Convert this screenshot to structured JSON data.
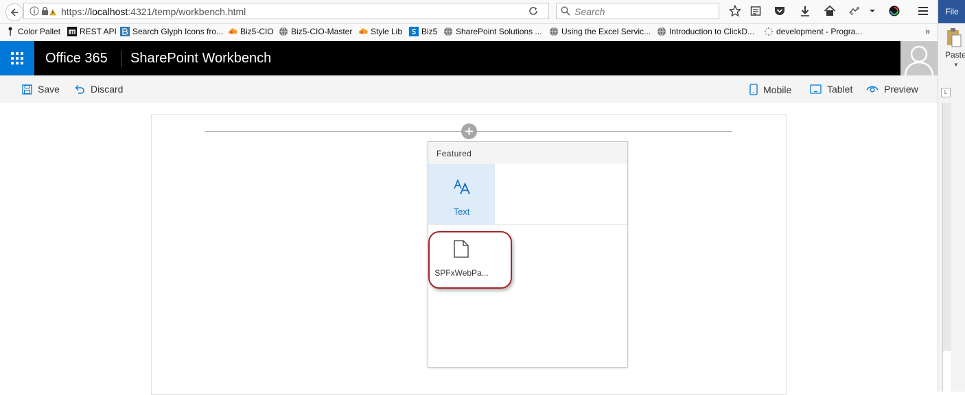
{
  "browser": {
    "url_prefix": "https://",
    "url_host": "localhost",
    "url_rest": ":4321/temp/workbench.html",
    "search_placeholder": "Search"
  },
  "bookmarks": [
    {
      "label": "Color Pallet",
      "icon": "pin-icon"
    },
    {
      "label": "REST API",
      "icon": "m-logo-icon"
    },
    {
      "label": "Search Glyph Icons fro...",
      "icon": "bootstrap-icon"
    },
    {
      "label": "Biz5-CIO",
      "icon": "cloud-icon"
    },
    {
      "label": "Biz5-CIO-Master",
      "icon": "globe-icon"
    },
    {
      "label": "Style Lib",
      "icon": "cloud-icon"
    },
    {
      "label": "Biz5",
      "icon": "sharepoint-icon"
    },
    {
      "label": "SharePoint Solutions ...",
      "icon": "globe-icon"
    },
    {
      "label": "Using the Excel Servic...",
      "icon": "globe-icon"
    },
    {
      "label": "Introduction to ClickD...",
      "icon": "globe-icon"
    },
    {
      "label": "development - Progra...",
      "icon": "spinner-icon"
    }
  ],
  "bookmarks_more": "»",
  "office_panel": {
    "file_tab": "File",
    "paste_label": "Paste"
  },
  "suite": {
    "title": "Office 365",
    "subtitle": "SharePoint Workbench"
  },
  "commands": {
    "save": "Save",
    "discard": "Discard",
    "mobile": "Mobile",
    "tablet": "Tablet",
    "preview": "Preview"
  },
  "toolbox": {
    "header": "Featured",
    "tiles": [
      {
        "label": "Text",
        "icon": "text-icon",
        "selected": true
      },
      {
        "label": "SPFxWebPa...",
        "icon": "page-icon",
        "selected": false
      }
    ]
  },
  "colors": {
    "accent": "#0078d7",
    "suite_bar": "#000000",
    "highlight": "#a4262c",
    "tile_selected": "#deecf9"
  }
}
